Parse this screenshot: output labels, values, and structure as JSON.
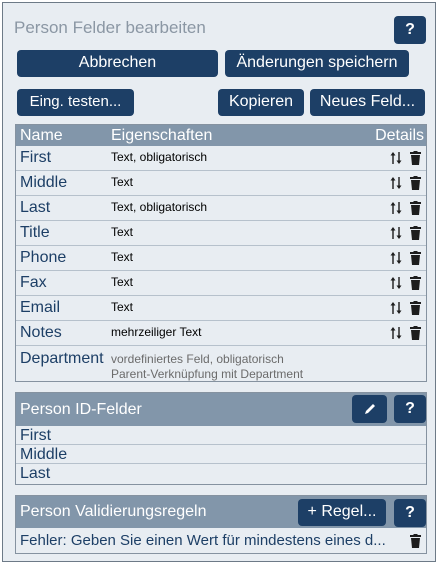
{
  "dialog": {
    "title": "Person Felder bearbeiten",
    "help_label": "?",
    "cancel_label": "Abbrechen",
    "save_label": "Änderungen speichern",
    "test_label": "Eing. testen...",
    "copy_label": "Kopieren",
    "new_field_label": "Neues Feld..."
  },
  "fields_table": {
    "headers": {
      "name": "Name",
      "properties": "Eigenschaften",
      "details": "Details"
    },
    "rows": [
      {
        "name": "First",
        "properties": "Text, obligatorisch"
      },
      {
        "name": "Middle",
        "properties": "Text"
      },
      {
        "name": "Last",
        "properties": "Text, obligatorisch"
      },
      {
        "name": "Title",
        "properties": "Text"
      },
      {
        "name": "Phone",
        "properties": "Text"
      },
      {
        "name": "Fax",
        "properties": "Text"
      },
      {
        "name": "Email",
        "properties": "Text"
      },
      {
        "name": "Notes",
        "properties": "mehrzeiliger Text"
      }
    ],
    "department": {
      "name": "Department",
      "line1": "vordefiniertes Feld, obligatorisch",
      "line2": "Parent-Verknüpfung mit Department"
    }
  },
  "id_fields": {
    "title": "Person ID-Felder",
    "help_label": "?",
    "items": [
      "First",
      "Middle",
      "Last"
    ]
  },
  "validation": {
    "title": "Person Validierungsregeln",
    "add_rule_label": "+ Regel...",
    "help_label": "?",
    "rule_text": "Fehler: Geben Sie einen Wert für mindestens eines d..."
  },
  "icons": {
    "sort": "sort-arrows-icon",
    "trash": "trash-icon",
    "edit": "pencil-icon"
  },
  "colors": {
    "button_bg": "#1d3f66",
    "panel_header": "#8296aa",
    "background": "#e8edf2"
  }
}
